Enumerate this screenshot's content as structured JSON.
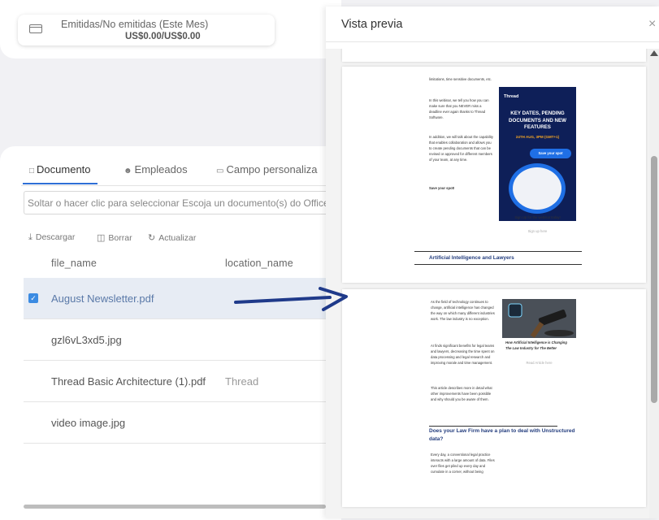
{
  "stats": {
    "label": "Emitidas/No emitidas (Este Mes)",
    "value": "US$0.00/US$0.00",
    "icon": "credit-card-icon"
  },
  "tabs": [
    {
      "label": "Documento",
      "icon": "document-icon"
    },
    {
      "label": "Empleados",
      "icon": "people-icon"
    },
    {
      "label": "Campo personaliza",
      "icon": "custom-field-icon"
    }
  ],
  "dropzone": {
    "text": "Soltar o hacer clic para seleccionar Escoja un documento(s) do Office"
  },
  "toolbar": {
    "download": "Descargar",
    "delete": "Borrar",
    "refresh": "Actualizar"
  },
  "table": {
    "columns": [
      "file_name",
      "location_name"
    ],
    "rows": [
      {
        "file_name": "August Newsletter.pdf",
        "location_name": "",
        "selected": true
      },
      {
        "file_name": "gzl6vL3xd5.jpg",
        "location_name": "",
        "selected": false
      },
      {
        "file_name": "Thread Basic Architecture (1).pdf",
        "location_name": "Thread",
        "selected": false
      },
      {
        "file_name": "video image.jpg",
        "location_name": "",
        "selected": false
      }
    ]
  },
  "preview": {
    "title": "Vista previa",
    "close": "×",
    "page1": {
      "p1": "limitations, time sensitive documents, etc.",
      "p2": "In this webinar, we tell you how you can make sure that you NEVER miss a deadline ever again thanks to Thread Software.",
      "p3": "In addition, we will talk about the capability that enables collaboration and allows you to create pending documents that can be revised or approved for different members of your team, at any time.",
      "p4": "Save your spot!",
      "banner_logo": "Thread",
      "banner_title": "KEY DATES, PENDING DOCUMENTS AND NEW FEATURES",
      "banner_date": "24TH AUG, 3PM (GMT+1)",
      "banner_button": "Save your spot",
      "signup_text": "Sign Up for the webinar today!",
      "signup_link": "Sign up here",
      "section_title": "Artificial Intelligence and Lawyers"
    },
    "page2": {
      "p1": "As the field of technology continues to change, artificial intelligence has changed the way on which many different industries work. The law industry is no exception.",
      "p2": "AI finds significant benefits for legal teams and lawyers, decreasing the time spent on data processing and legal research and improving morale and time management.",
      "p3": "This article describes more in detail what other improvements have been possible and why should you be aware of them.",
      "caption": "How Artificial Intelligence is Changing The Law Industry for The Better",
      "read_link": "Read Article here",
      "section_title": "Does your Law Firm have a plan to deal with Unstructured data?",
      "p4": "Every day, a conventional legal practice interacts with a large amount of data. Files over files get piled up every day and cumulate in a corner, without being"
    }
  },
  "colors": {
    "accent": "#2f6fd6",
    "arrow": "#1f3a8a",
    "banner_bg": "#0e1f58",
    "selected_row": "#e7ecf4"
  }
}
